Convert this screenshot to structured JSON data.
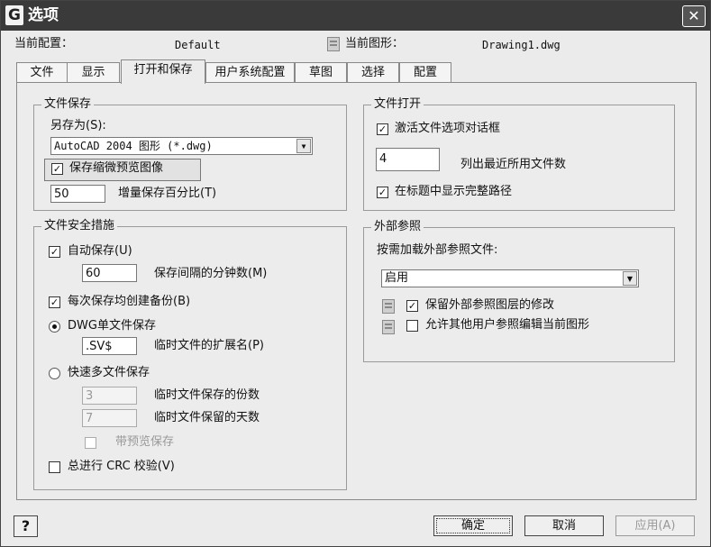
{
  "window": {
    "title": "选项",
    "app_icon_glyph": "G",
    "close_glyph": "✕"
  },
  "profile": {
    "current_label": "当前配置：",
    "current_value": "Default",
    "drawing_label": "当前图形：",
    "drawing_value": "Drawing1.dwg"
  },
  "tabs": [
    "文件",
    "显示",
    "打开和保存",
    "用户系统配置",
    "草图",
    "选择",
    "配置"
  ],
  "file_save": {
    "legend": "文件保存",
    "save_as_label": "另存为(S):",
    "save_as_value": "AutoCAD 2004 图形 (*.dwg)",
    "thumbnail_label": "保存缩微预览图像",
    "thumbnail_checked": true,
    "incremental_value": "50",
    "incremental_label": "增量保存百分比(T)"
  },
  "file_safety": {
    "legend": "文件安全措施",
    "autosave_label": "自动保存(U)",
    "autosave_checked": true,
    "minutes_value": "60",
    "minutes_label": "保存间隔的分钟数(M)",
    "backup_label": "每次保存均创建备份(B)",
    "backup_checked": true,
    "dwg_single_label": "DWG单文件保存",
    "temp_ext_value": ".SV$",
    "temp_ext_label": "临时文件的扩展名(P)",
    "quick_multi_label": "快速多文件保存",
    "temp_count_value": "3",
    "temp_count_label": "临时文件保存的份数",
    "temp_days_value": "7",
    "temp_days_label": "临时文件保留的天数",
    "preview_save_label": "带预览保存",
    "crc_label": "总进行 CRC 校验(V)",
    "crc_checked": false
  },
  "file_open": {
    "legend": "文件打开",
    "activate_label": "激活文件选项对话框",
    "activate_checked": true,
    "recent_value": "4",
    "recent_label": "列出最近所用文件数",
    "fullpath_label": "在标题中显示完整路径",
    "fullpath_checked": true
  },
  "xref": {
    "legend": "外部参照",
    "demand_label": "按需加载外部参照文件:",
    "demand_value": "启用",
    "retain_label": "保留外部参照图层的修改",
    "retain_checked": true,
    "allow_label": "允许其他用户参照编辑当前图形",
    "allow_checked": false
  },
  "buttons": {
    "help": "?",
    "ok": "确定",
    "cancel": "取消",
    "apply": "应用(A)"
  }
}
